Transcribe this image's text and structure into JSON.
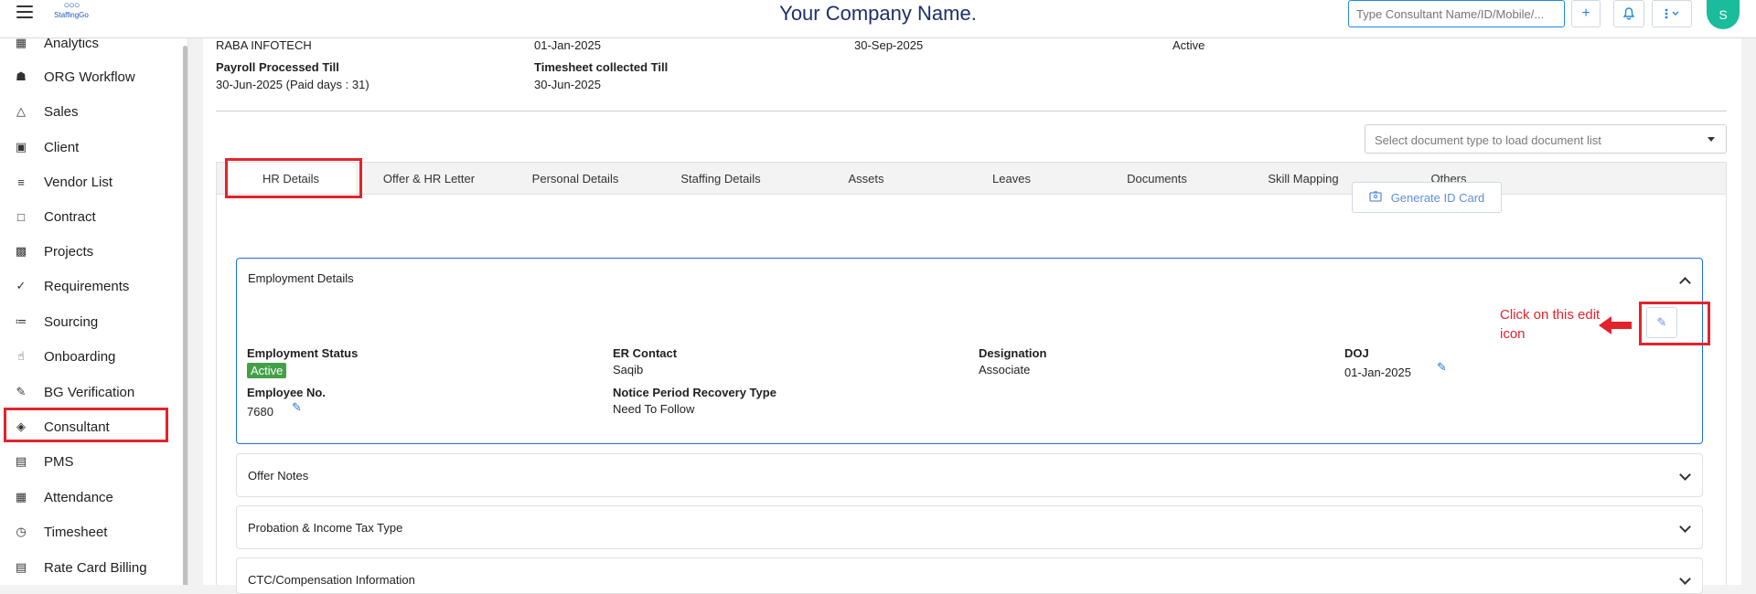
{
  "header": {
    "logo_mark": "○○○",
    "logo_text": "StaffingGo",
    "company": "Your Company Name.",
    "search_placeholder": "Type Consultant Name/ID/Mobile/...",
    "add_label": "+",
    "avatar": "S"
  },
  "sidebar": {
    "items": [
      {
        "label": "Analytics",
        "icon": "analytics-icon"
      },
      {
        "label": "ORG Workflow",
        "icon": "workflow-icon"
      },
      {
        "label": "Sales",
        "icon": "sales-icon"
      },
      {
        "label": "Client",
        "icon": "client-icon"
      },
      {
        "label": "Vendor List",
        "icon": "vendor-list-icon"
      },
      {
        "label": "Contract",
        "icon": "contract-icon"
      },
      {
        "label": "Projects",
        "icon": "projects-icon"
      },
      {
        "label": "Requirements",
        "icon": "requirements-icon"
      },
      {
        "label": "Sourcing",
        "icon": "sourcing-icon"
      },
      {
        "label": "Onboarding",
        "icon": "onboarding-icon"
      },
      {
        "label": "BG Verification",
        "icon": "bg-verification-icon"
      },
      {
        "label": "Consultant",
        "icon": "consultant-icon"
      },
      {
        "label": "PMS",
        "icon": "pms-icon"
      },
      {
        "label": "Attendance",
        "icon": "attendance-icon"
      },
      {
        "label": "Timesheet",
        "icon": "timesheet-icon"
      },
      {
        "label": "Rate Card Billing",
        "icon": "rate-card-icon"
      }
    ]
  },
  "summary": {
    "row1": [
      "RABA INFOTECH",
      "01-Jan-2025",
      "30-Sep-2025",
      "Active"
    ],
    "payroll_label": "Payroll Processed Till",
    "payroll_value": "30-Jun-2025 (Paid days : 31)",
    "timesheet_label": "Timesheet collected Till",
    "timesheet_value": "30-Jun-2025"
  },
  "doc_select": {
    "placeholder": "Select document type to load document list"
  },
  "tabs": [
    "HR Details",
    "Offer & HR Letter",
    "Personal Details",
    "Staffing Details",
    "Assets",
    "Leaves",
    "Documents",
    "Skill Mapping",
    "Others"
  ],
  "generate_id_card": "Generate ID Card",
  "employment": {
    "title": "Employment Details",
    "status_label": "Employment Status",
    "status_value": "Active",
    "er_contact_label": "ER Contact",
    "er_contact_value": "Saqib",
    "designation_label": "Designation",
    "designation_value": "Associate",
    "doj_label": "DOJ",
    "doj_value": "01-Jan-2025",
    "emp_no_label": "Employee No.",
    "emp_no_value": "7680",
    "notice_label": "Notice Period Recovery Type",
    "notice_value": "Need To Follow"
  },
  "sections": [
    "Offer Notes",
    "Probation & Income Tax Type",
    "CTC/Compensation Information"
  ],
  "annotation": {
    "text": "Click on this edit icon"
  },
  "colors": {
    "highlight": "#e3232c",
    "accent": "#1e6fd9",
    "active_badge": "#43a047"
  }
}
